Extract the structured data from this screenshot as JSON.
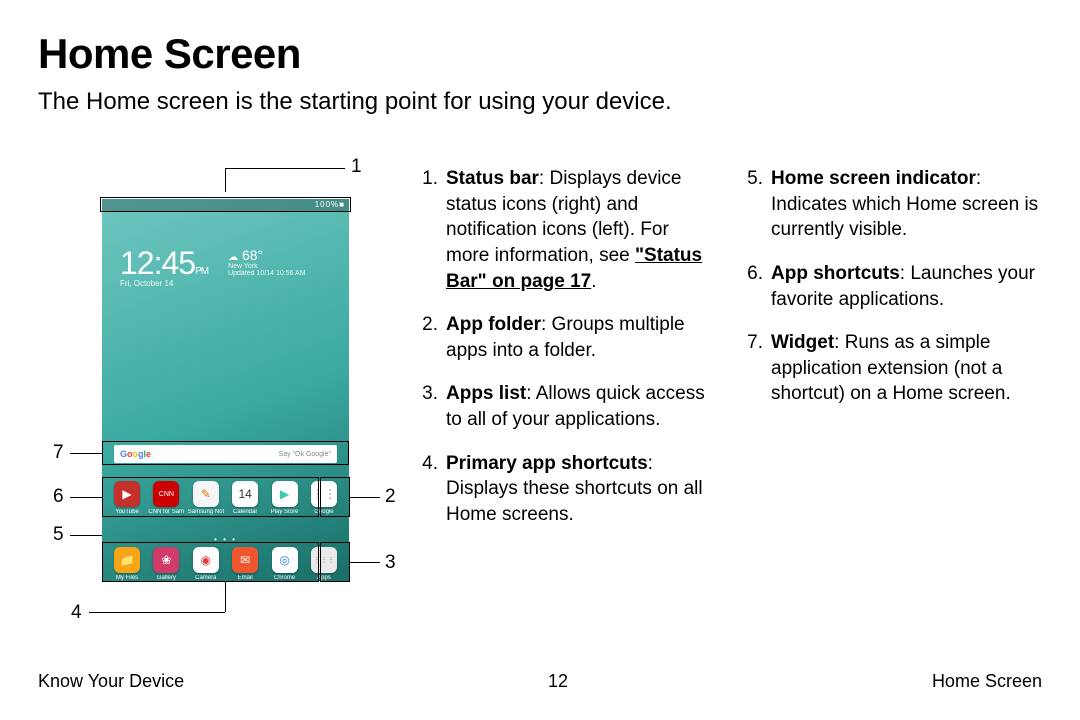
{
  "title": "Home Screen",
  "subtitle": "The Home screen is the starting point for using your device.",
  "callout_nums": {
    "n1": "1",
    "n2": "2",
    "n3": "3",
    "n4": "4",
    "n5": "5",
    "n6": "6",
    "n7": "7"
  },
  "device": {
    "status_right": "100%■",
    "clock": {
      "time": "12:45",
      "ampm": "PM",
      "date": "Fri, October 14"
    },
    "weather": {
      "temp": "68°",
      "city": "New York",
      "updated": "Updated 10/14 10:56 AM"
    },
    "search": {
      "logo": "Google",
      "hint": "Say \"Ok Google\""
    },
    "row_apps": [
      {
        "label": "YouTube",
        "color": "#c4302b",
        "glyph": "▶"
      },
      {
        "label": "CNN for Samsung",
        "color": "#cc0000",
        "glyph": "CNN"
      },
      {
        "label": "Samsung Notes",
        "color": "#f6f6f6",
        "glyph": "✎",
        "fg": "#d97d0d"
      },
      {
        "label": "Calendar",
        "color": "#ffffff",
        "glyph": "14",
        "fg": "#333"
      },
      {
        "label": "Play Store",
        "color": "#ffffff",
        "glyph": "▶",
        "fg": "#3bccad"
      },
      {
        "label": "Google",
        "color": "#ffffff",
        "glyph": "⋮⋮",
        "fg": "#888"
      }
    ],
    "row_dock": [
      {
        "label": "My Files",
        "color": "#f7a515",
        "glyph": "📁"
      },
      {
        "label": "Gallery",
        "color": "#d03b6a",
        "glyph": "❀"
      },
      {
        "label": "Camera",
        "color": "#ffffff",
        "glyph": "◉",
        "fg": "#e04242"
      },
      {
        "label": "Email",
        "color": "#ef5630",
        "glyph": "✉"
      },
      {
        "label": "Chrome",
        "color": "#ffffff",
        "glyph": "◎",
        "fg": "#2b7de9"
      },
      {
        "label": "Apps",
        "color": "#e9e9e9",
        "glyph": "⋮⋮⋮",
        "fg": "#777"
      }
    ],
    "indicator": "• • •"
  },
  "list_col1": [
    {
      "n": "1.",
      "bold": "Status bar",
      "text": ": Displays device status icons (right) and notification icons (left). For more information, see ",
      "link": "\"Status Bar\" on page 17",
      "after": "."
    },
    {
      "n": "2.",
      "bold": "App folder",
      "text": ": Groups multiple apps into a folder."
    },
    {
      "n": "3.",
      "bold": "Apps list",
      "text": ": Allows quick access to all of your applications."
    },
    {
      "n": "4.",
      "bold": "Primary app shortcuts",
      "text": ": Displays these shortcuts on all Home screens."
    }
  ],
  "list_col2": [
    {
      "n": "5.",
      "bold": "Home screen indicator",
      "text": ": Indicates which Home screen is currently visible."
    },
    {
      "n": "6.",
      "bold": "App shortcuts",
      "text": ": Launches your favorite applications."
    },
    {
      "n": "7.",
      "bold": "Widget",
      "text": ": Runs as a simple application extension (not a shortcut) on a Home screen."
    }
  ],
  "footer": {
    "left": "Know Your Device",
    "center": "12",
    "right": "Home Screen"
  }
}
